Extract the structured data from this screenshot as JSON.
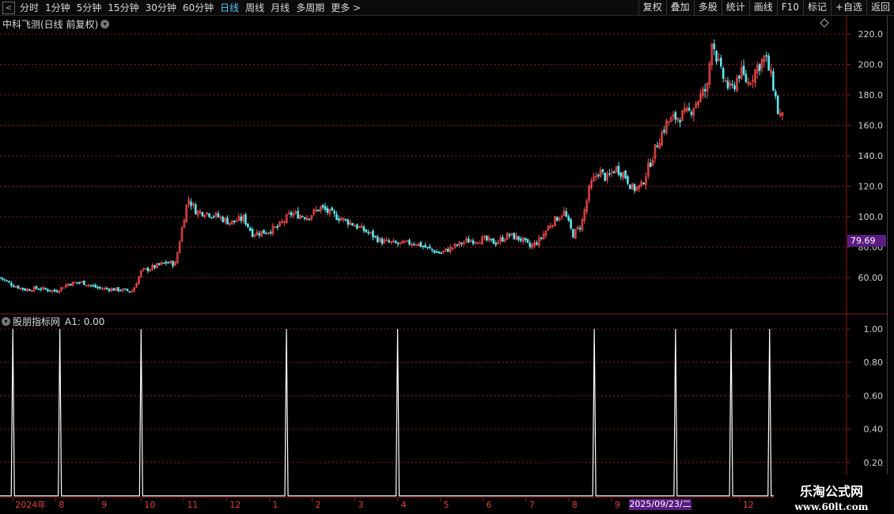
{
  "toolbar": {
    "back_glyph": "<",
    "periods": [
      "分时",
      "1分钟",
      "5分钟",
      "15分钟",
      "30分钟",
      "60分钟",
      "日线",
      "周线",
      "月线",
      "多周期",
      "更多 >"
    ],
    "active_period": "日线",
    "right_buttons": [
      "复权",
      "叠加",
      "多股",
      "统计",
      "画线",
      "F10",
      "标记",
      "+自选",
      "返回"
    ]
  },
  "main_panel": {
    "title": "中科飞测(日线 前复权)",
    "price_axis_labels": [
      "220.0",
      "200.0",
      "180.0",
      "160.0",
      "140.0",
      "120.0",
      "100.0",
      "80.00",
      "60.00"
    ],
    "current_price_label": "79.69",
    "diamond_icon": "diamond-icon"
  },
  "sub_panel": {
    "title": "股朋指标网",
    "indicator_value": "A1: 0.00",
    "axis_labels": [
      "1.00",
      "0.80",
      "0.60",
      "0.40",
      "0.20"
    ]
  },
  "date_axis": {
    "labels": [
      {
        "text": "2024年",
        "month": 7
      },
      {
        "text": "8",
        "month": 8
      },
      {
        "text": "9",
        "month": 9
      },
      {
        "text": "10",
        "month": 10
      },
      {
        "text": "11",
        "month": 11
      },
      {
        "text": "12",
        "month": 12
      },
      {
        "text": "1",
        "month": 13
      },
      {
        "text": "2",
        "month": 14
      },
      {
        "text": "3",
        "month": 15
      },
      {
        "text": "4",
        "month": 16
      },
      {
        "text": "5",
        "month": 17
      },
      {
        "text": "6",
        "month": 18
      },
      {
        "text": "7",
        "month": 19
      },
      {
        "text": "8",
        "month": 20
      },
      {
        "text": "9",
        "month": 21
      },
      {
        "text": "12",
        "month": 24
      },
      {
        "text": "1",
        "month": 25
      }
    ],
    "highlight_label": "2025/09/23/二"
  },
  "watermark": {
    "line1": "乐淘公式网",
    "line2": "www.60lt.com"
  },
  "colors": {
    "up": "#ff4d4d",
    "down": "#5ee6f0",
    "grid": "#8a1a1a",
    "axis_text": "#d0d0d0",
    "highlight": "#5a1b82",
    "active_period": "#58c8ff"
  },
  "chart_data": [
    {
      "type": "candlestick",
      "title": "中科飞测(日线 前复权)",
      "ylim": [
        40,
        225
      ],
      "y_ticks": [
        60,
        80,
        100,
        120,
        140,
        160,
        180,
        200,
        220
      ],
      "x_range_months": [
        6.7,
        26.5
      ],
      "close_path": [
        [
          6.7,
          60
        ],
        [
          7.0,
          55
        ],
        [
          7.3,
          52
        ],
        [
          7.6,
          53
        ],
        [
          8.0,
          51
        ],
        [
          8.3,
          56
        ],
        [
          8.6,
          57
        ],
        [
          9.0,
          53
        ],
        [
          9.5,
          52
        ],
        [
          9.8,
          51
        ],
        [
          10.0,
          64
        ],
        [
          10.2,
          66
        ],
        [
          10.4,
          68
        ],
        [
          10.6,
          70
        ],
        [
          10.8,
          69
        ],
        [
          11.0,
          99
        ],
        [
          11.1,
          112
        ],
        [
          11.3,
          103
        ],
        [
          11.5,
          103
        ],
        [
          11.8,
          100
        ],
        [
          12.1,
          96
        ],
        [
          12.4,
          99
        ],
        [
          12.6,
          89
        ],
        [
          12.9,
          90
        ],
        [
          13.2,
          93
        ],
        [
          13.5,
          102
        ],
        [
          13.9,
          100
        ],
        [
          14.2,
          106
        ],
        [
          14.5,
          101
        ],
        [
          14.9,
          96
        ],
        [
          15.4,
          88
        ],
        [
          15.6,
          84
        ],
        [
          16.0,
          82
        ],
        [
          16.4,
          83
        ],
        [
          16.8,
          78
        ],
        [
          17.0,
          76
        ],
        [
          17.3,
          80
        ],
        [
          17.6,
          84
        ],
        [
          18.0,
          85
        ],
        [
          18.3,
          83
        ],
        [
          18.6,
          88
        ],
        [
          18.9,
          85
        ],
        [
          19.1,
          80
        ],
        [
          19.3,
          84
        ],
        [
          19.6,
          96
        ],
        [
          19.9,
          103
        ],
        [
          20.1,
          88
        ],
        [
          20.3,
          95
        ],
        [
          20.5,
          120
        ],
        [
          20.7,
          130
        ],
        [
          20.9,
          125
        ],
        [
          21.1,
          132
        ],
        [
          21.3,
          128
        ],
        [
          21.5,
          118
        ],
        [
          21.7,
          120
        ],
        [
          21.9,
          135
        ],
        [
          22.1,
          150
        ],
        [
          22.3,
          162
        ],
        [
          22.5,
          165
        ],
        [
          22.8,
          168
        ],
        [
          22.9,
          172
        ],
        [
          23.1,
          180
        ],
        [
          23.25,
          185
        ],
        [
          23.35,
          218
        ],
        [
          23.55,
          195
        ],
        [
          23.8,
          182
        ],
        [
          24.0,
          195
        ],
        [
          24.2,
          188
        ],
        [
          24.4,
          198
        ],
        [
          24.6,
          205
        ],
        [
          24.8,
          185
        ],
        [
          24.9,
          168
        ],
        [
          25.0,
          165
        ]
      ]
    },
    {
      "type": "line",
      "title": "股朋指标网",
      "series": [
        {
          "name": "A1",
          "values": [
            0.0
          ]
        }
      ],
      "ylim": [
        0,
        1.05
      ],
      "spike_months": [
        7.0,
        8.1,
        10.0,
        13.4,
        16.0,
        20.6,
        22.5,
        23.8,
        24.7,
        27.3
      ],
      "spike_value": 1.0
    }
  ]
}
